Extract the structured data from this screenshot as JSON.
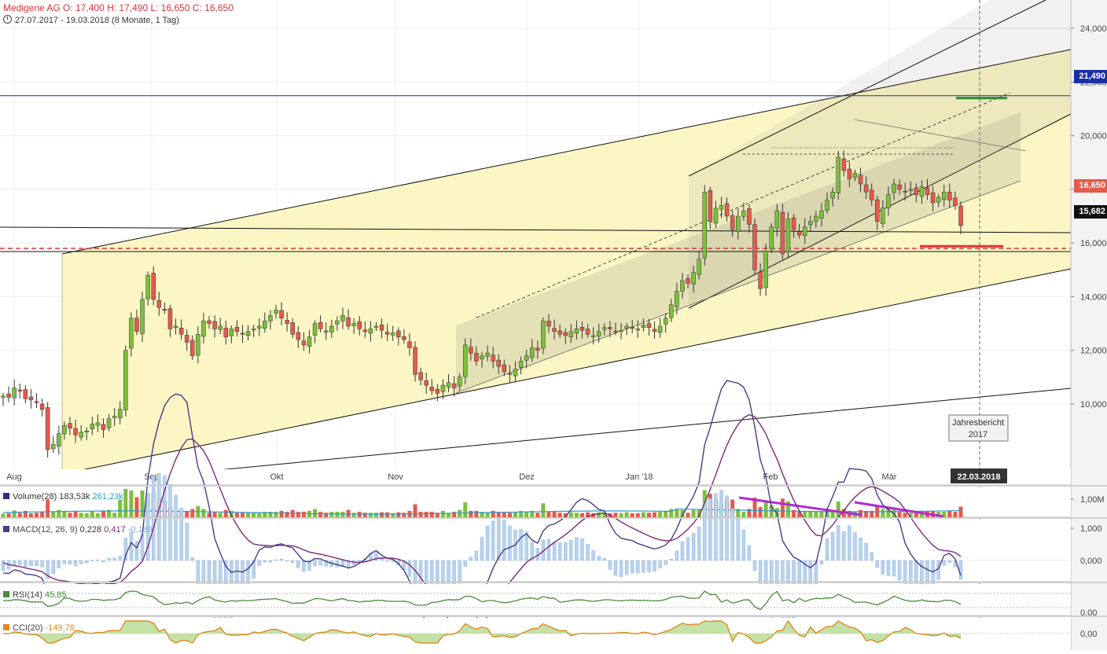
{
  "header": {
    "title_line": "Medigene AG  O: 17,400  H: 17,490  L: 16,650  C: 16,650",
    "range_line": "27.07.2017 - 19.03.2018   (8 Monate, 1 Tag)"
  },
  "price_axis": {
    "ticks": [
      "24,000",
      "22,000",
      "20,000",
      "18,000",
      "16,000",
      "14,000",
      "12,000",
      "10,000"
    ],
    "tag_high": "21,490",
    "tag_last": "16,650",
    "tag_support": "15,682"
  },
  "time_axis": {
    "labels": [
      "Aug",
      "Sep",
      "Okt",
      "Nov",
      "Dez",
      "Jan '18",
      "Feb",
      "Mär"
    ],
    "cursor_date": "22.03.2018"
  },
  "annotation": {
    "line1": "Jahresbericht",
    "line2": "2017"
  },
  "volume_panel": {
    "label": "Volume(28)",
    "v1": "183,53k",
    "v2": "261,23k",
    "axis": "1,00M"
  },
  "macd_panel": {
    "label": "MACD(12, 26, 9)",
    "v1": "0,228",
    "v2": "0,417",
    "v3": "-0,189",
    "axis_top": "1,000",
    "axis_zero": "0,000"
  },
  "rsi_panel": {
    "label": "RSI(14)",
    "v1": "45,85",
    "axis": "0,00"
  },
  "cci_panel": {
    "label": "CCI(20)",
    "v1": "-149,78",
    "axis": "0,00"
  },
  "colors": {
    "up": "#7cbf3c",
    "down": "#e55a4b",
    "channel_fill": "#fbf6c4",
    "accent_blue": "#1a2fa6",
    "accent_red": "#e0313a",
    "purple": "#b12bd6"
  },
  "chart_data": {
    "type": "candlestick",
    "x_start": "2017-07-27",
    "x_end": "2018-03-19",
    "ylim": [
      8.0,
      25.0
    ],
    "closes": [
      10.3,
      10.25,
      10.6,
      10.5,
      10.2,
      10.15,
      10.05,
      9.8,
      8.3,
      8.5,
      8.9,
      9.2,
      9.1,
      8.85,
      8.95,
      9.0,
      9.25,
      9.3,
      9.05,
      9.45,
      9.55,
      9.8,
      12.0,
      13.2,
      12.7,
      13.9,
      14.8,
      13.9,
      13.6,
      13.5,
      12.8,
      12.9,
      12.6,
      12.3,
      11.8,
      12.6,
      13.1,
      13.0,
      12.8,
      12.9,
      12.5,
      12.8,
      12.7,
      12.6,
      12.7,
      12.8,
      12.9,
      13.1,
      13.3,
      13.5,
      13.2,
      13.0,
      12.6,
      12.4,
      12.2,
      12.5,
      13.0,
      12.8,
      12.7,
      12.9,
      13.1,
      13.3,
      12.9,
      13.0,
      12.8,
      12.7,
      12.8,
      12.9,
      12.75,
      12.6,
      12.65,
      12.5,
      12.4,
      12.1,
      11.1,
      10.9,
      10.7,
      10.5,
      10.4,
      10.7,
      10.8,
      10.6,
      11.0,
      12.2,
      11.9,
      11.6,
      11.8,
      11.9,
      11.6,
      11.4,
      11.2,
      11.1,
      11.3,
      11.6,
      11.8,
      12.1,
      12.0,
      13.1,
      12.9,
      12.7,
      12.6,
      12.55,
      12.7,
      12.8,
      12.75,
      12.6,
      12.55,
      12.7,
      12.85,
      12.8,
      12.7,
      12.75,
      12.9,
      12.85,
      12.8,
      12.95,
      12.85,
      12.7,
      12.9,
      13.2,
      13.7,
      14.2,
      14.6,
      14.5,
      14.9,
      15.4,
      17.9,
      16.8,
      17.3,
      17.4,
      17.0,
      16.5,
      17.0,
      17.2,
      16.7,
      15.0,
      14.3,
      15.7,
      16.6,
      17.2,
      15.6,
      16.9,
      16.5,
      16.3,
      16.6,
      16.8,
      17.0,
      17.2,
      17.6,
      17.9,
      19.2,
      18.7,
      18.4,
      18.6,
      18.2,
      17.9,
      17.6,
      16.8,
      17.3,
      17.8,
      18.2,
      18.0,
      17.9,
      18.0,
      17.8,
      18.1,
      17.8,
      17.5,
      17.7,
      17.9,
      17.6,
      17.4,
      16.65
    ],
    "last": 16.65,
    "high_line": 21.49,
    "support_line": 15.682
  }
}
